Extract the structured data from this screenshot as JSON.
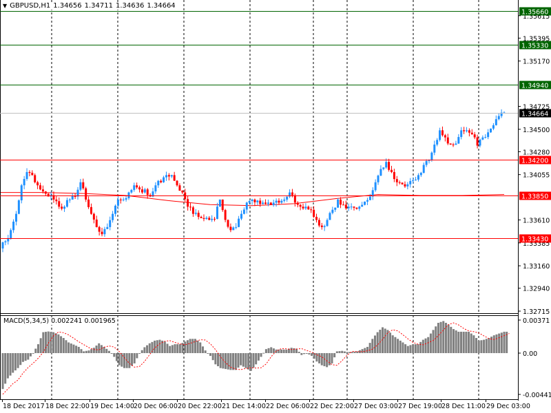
{
  "header": {
    "symbol": "GBPUSD,H1",
    "open": "1.34656",
    "high": "1.34711",
    "low": "1.34636",
    "close": "1.34664"
  },
  "colors": {
    "bull": "#1e90ff",
    "bear": "#ff0000",
    "resistance": "#006400",
    "support": "#ff0000",
    "current": "#c0c0c0",
    "histogram": "#808080",
    "signal": "#ff0000"
  },
  "price_axis": {
    "range": [
      1.32715,
      1.3566
    ],
    "ticks": [
      "1.35615",
      "1.35395",
      "1.35170",
      "1.34725",
      "1.34500",
      "1.34280",
      "1.34055",
      "1.33610",
      "1.33385",
      "1.33160",
      "1.32940",
      "1.32715"
    ]
  },
  "levels": [
    {
      "label": "1.35660",
      "type": "resistance"
    },
    {
      "label": "1.35330",
      "type": "resistance"
    },
    {
      "label": "1.34940",
      "type": "resistance"
    },
    {
      "label": "1.34664",
      "type": "current"
    },
    {
      "label": "1.34200",
      "type": "support"
    },
    {
      "label": "1.33850",
      "type": "support"
    },
    {
      "label": "1.33430",
      "type": "support"
    }
  ],
  "chart_data": {
    "type": "candlestick",
    "closes": [
      1.3333,
      1.334,
      1.3351,
      1.3367,
      1.3395,
      1.3408,
      1.3405,
      1.3395,
      1.3389,
      1.3384,
      1.3381,
      1.3374,
      1.3374,
      1.3381,
      1.3384,
      1.3398,
      1.3381,
      1.3367,
      1.3354,
      1.3347,
      1.3354,
      1.3367,
      1.3381,
      1.3381,
      1.3388,
      1.3395,
      1.3391,
      1.3391,
      1.3384,
      1.3395,
      1.3398,
      1.3405,
      1.3405,
      1.3395,
      1.3388,
      1.3374,
      1.3367,
      1.3364,
      1.3362,
      1.3361,
      1.3362,
      1.3381,
      1.3361,
      1.3351,
      1.3354,
      1.3367,
      1.3378,
      1.3381,
      1.338,
      1.3378,
      1.3378,
      1.3378,
      1.3378,
      1.3381,
      1.3388,
      1.3378,
      1.3374,
      1.3374,
      1.3371,
      1.3361,
      1.3354,
      1.3361,
      1.3371,
      1.3381,
      1.3376,
      1.3374,
      1.3373,
      1.3374,
      1.3379,
      1.3384,
      1.3398,
      1.3411,
      1.3418,
      1.3408,
      1.3398,
      1.3396,
      1.3396,
      1.34,
      1.3405,
      1.3415,
      1.342,
      1.3435,
      1.3449,
      1.3442,
      1.3435,
      1.3436,
      1.3449,
      1.3449,
      1.3445,
      1.3434,
      1.3442,
      1.3447,
      1.3454,
      1.3463,
      1.34664
    ],
    "moving_average": [
      1.3388,
      1.3388,
      1.3387,
      1.3385,
      1.338,
      1.3376,
      1.3375,
      1.3377,
      1.3382,
      1.3386,
      1.3385,
      1.3385,
      1.3386
    ],
    "time_labels": [
      "18 Dec 2017",
      "18 Dec 22:00",
      "19 Dec 14:00",
      "20 Dec 06:00",
      "20 Dec 22:00",
      "21 Dec 14:00",
      "22 Dec 06:00",
      "22 Dec 22:00",
      "27 Dec 03:00",
      "27 Dec 19:00",
      "28 Dec 11:00",
      "29 Dec 03:00"
    ]
  },
  "macd": {
    "title": "MACD(5,34,5)",
    "main": "0.002241",
    "signal": "0.001965",
    "signal_period": 5,
    "axis_ticks": [
      "0.00371",
      "0.00",
      "-0.004417"
    ],
    "range": [
      -0.004417,
      0.00371
    ],
    "histogram": [
      -0.00384,
      -0.0027,
      -0.0021,
      -0.0016,
      -0.00094,
      -0.0007,
      0,
      0.001,
      0.00235,
      0.00243,
      0.00235,
      0.0021,
      0.0017,
      0.0012,
      0.00096,
      0.0007,
      0.0002,
      0.0003,
      0.0006,
      0.0011,
      0.0007,
      0.00025,
      -0.0004,
      -0.0013,
      -0.0016,
      -0.0016,
      -0.0011,
      0,
      0.00066,
      0.0011,
      0.0014,
      0.0015,
      0.0013,
      0.0008,
      0.001,
      0.001,
      0.0013,
      0.0016,
      0.0016,
      0.0012,
      0.0003,
      -0.0003,
      -0.0012,
      -0.0016,
      -0.0017,
      -0.0018,
      -0.0018,
      -0.0013,
      -0.0016,
      -0.0019,
      -0.0012,
      -0.0004,
      0.00045,
      0.00066,
      0.0004,
      0.0004,
      0.0004,
      0.0006,
      0.0005,
      -0.0002,
      0,
      -0.0003,
      -0.0009,
      -0.0013,
      -0.0015,
      -0.0011,
      0.0002,
      0.00025,
      0.00013,
      0.00013,
      0.0002,
      0.00045,
      0.0007,
      0.0016,
      0.00235,
      0.0029,
      0.0026,
      0.002,
      0.0016,
      0.0012,
      0.0008,
      0.001,
      0.001,
      0.0015,
      0.0018,
      0.0026,
      0.0034,
      0.0036,
      0.0032,
      0.0027,
      0.0024,
      0.0024,
      0.0024,
      0.002,
      0.0014,
      0.0015,
      0.0017,
      0.002,
      0.0022,
      0.0024
    ]
  }
}
